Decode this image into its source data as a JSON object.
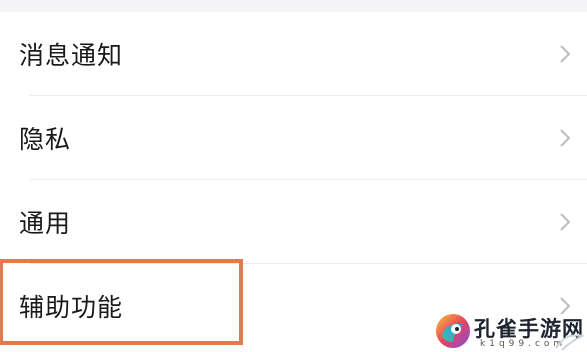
{
  "settings_list": {
    "items": [
      {
        "id": "notifications",
        "label": "消息通知",
        "icon": "chevron-right-icon"
      },
      {
        "id": "privacy",
        "label": "隐私",
        "icon": "chevron-right-icon"
      },
      {
        "id": "general",
        "label": "通用",
        "icon": "chevron-right-icon"
      },
      {
        "id": "accessibility",
        "label": "辅助功能",
        "icon": "chevron-right-icon",
        "highlighted": true
      }
    ]
  },
  "colors": {
    "highlight_border": "#e07a4f",
    "chevron": "#bdbdbd",
    "divider": "#ececec",
    "top_strip": "#f4f4f6"
  },
  "watermark": {
    "title": "孔雀手游网",
    "url": "k1q99.com",
    "icon": "peacock-logo-icon"
  }
}
